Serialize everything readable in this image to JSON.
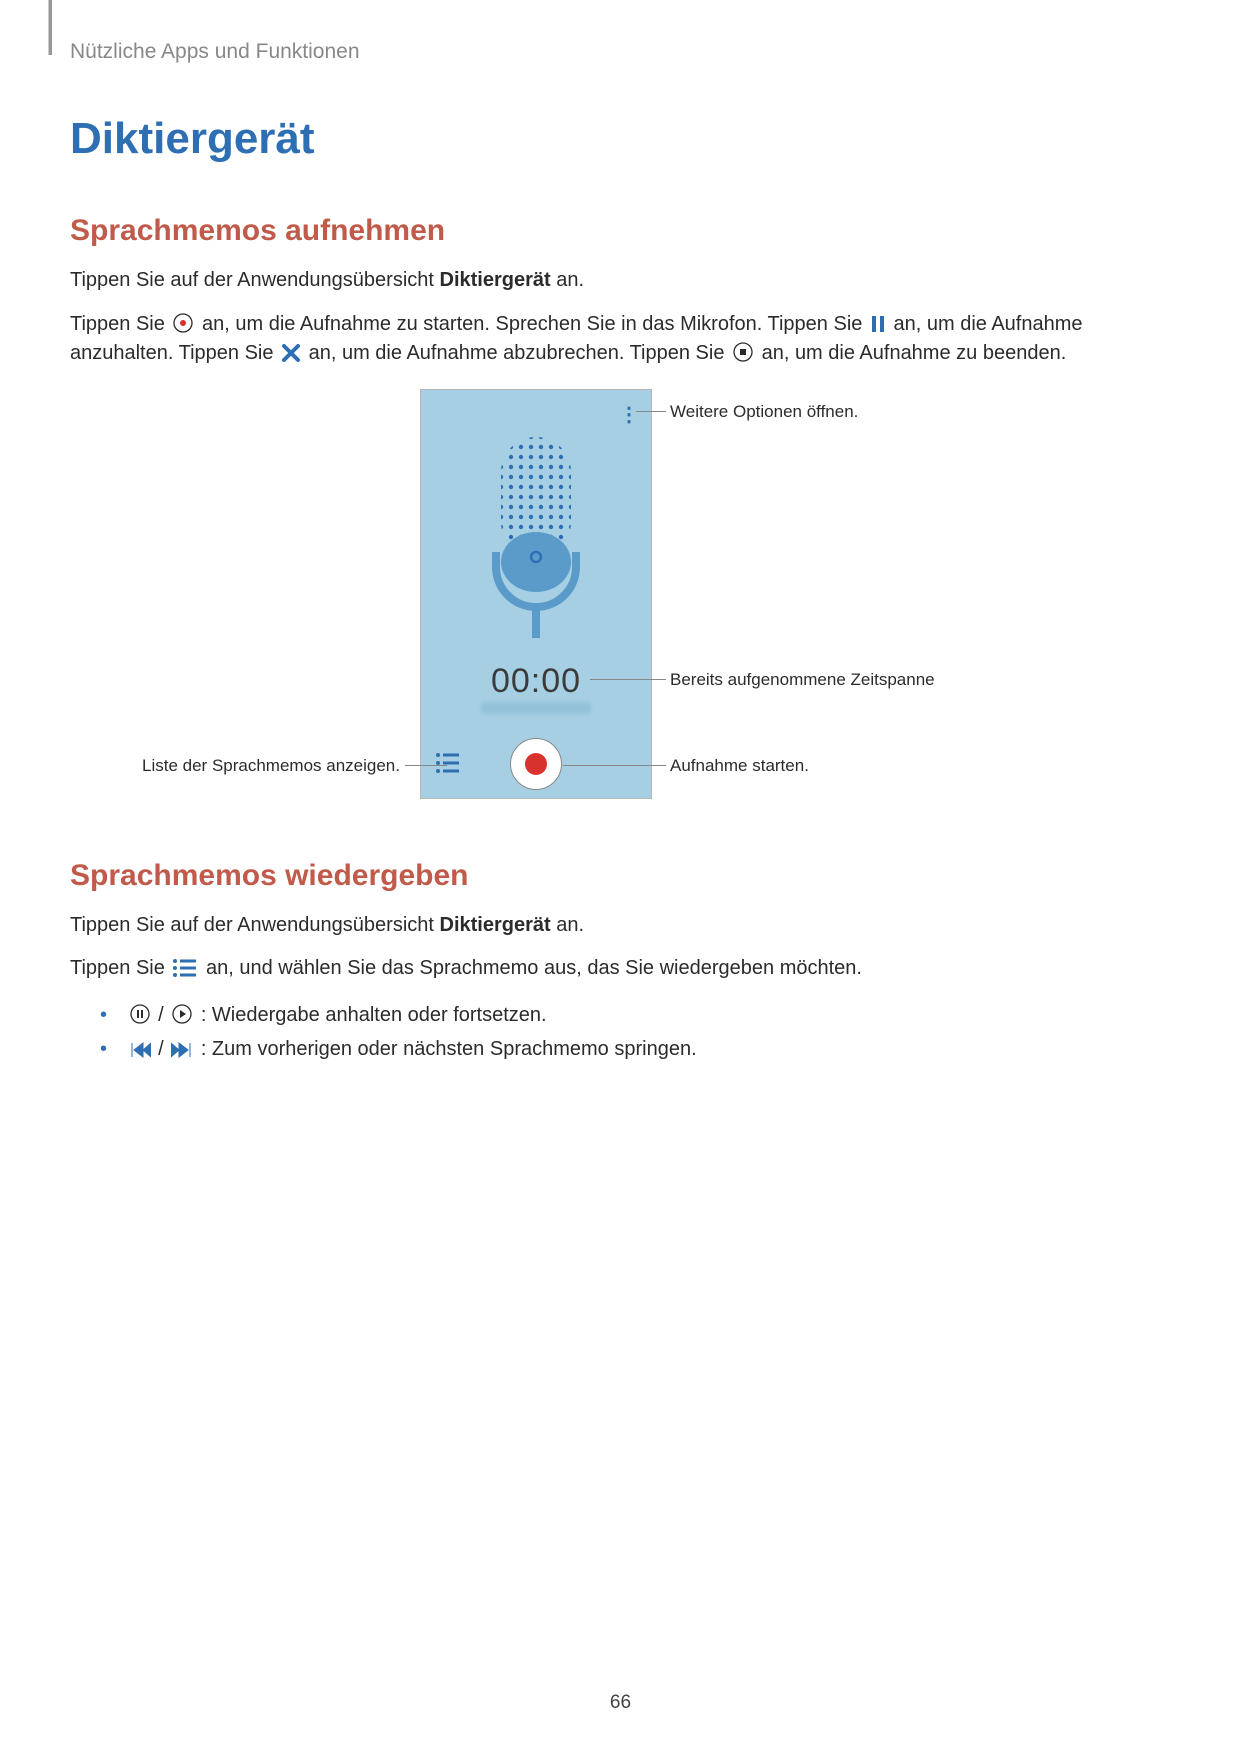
{
  "breadcrumb": "Nützliche Apps und Funktionen",
  "h1": "Diktiergerät",
  "section1": {
    "title": "Sprachmemos aufnehmen",
    "p1a": "Tippen Sie auf der Anwendungsübersicht ",
    "p1b": "Diktiergerät",
    "p1c": " an.",
    "p2a": "Tippen Sie ",
    "p2b": " an, um die Aufnahme zu starten. Sprechen Sie in das Mikrofon. Tippen Sie ",
    "p2c": " an, um die Aufnahme anzuhalten. Tippen Sie ",
    "p2d": " an, um die Aufnahme abzubrechen. Tippen Sie ",
    "p2e": " an, um die Aufnahme zu beenden."
  },
  "figure": {
    "timer": "00:00",
    "callout_more": "Weitere Optionen öffnen.",
    "callout_time": "Bereits aufgenommene Zeitspanne",
    "callout_rec": "Aufnahme starten.",
    "callout_list": "Liste der Sprachmemos anzeigen."
  },
  "section2": {
    "title": "Sprachmemos wiedergeben",
    "p1a": "Tippen Sie auf der Anwendungsübersicht ",
    "p1b": "Diktiergerät",
    "p1c": " an.",
    "p2a": "Tippen Sie ",
    "p2b": " an, und wählen Sie das Sprachmemo aus, das Sie wiedergeben möchten.",
    "li1": " : Wiedergabe anhalten oder fortsetzen.",
    "li2": " : Zum vorherigen oder nächsten Sprachmemo springen."
  },
  "page_number": "66"
}
